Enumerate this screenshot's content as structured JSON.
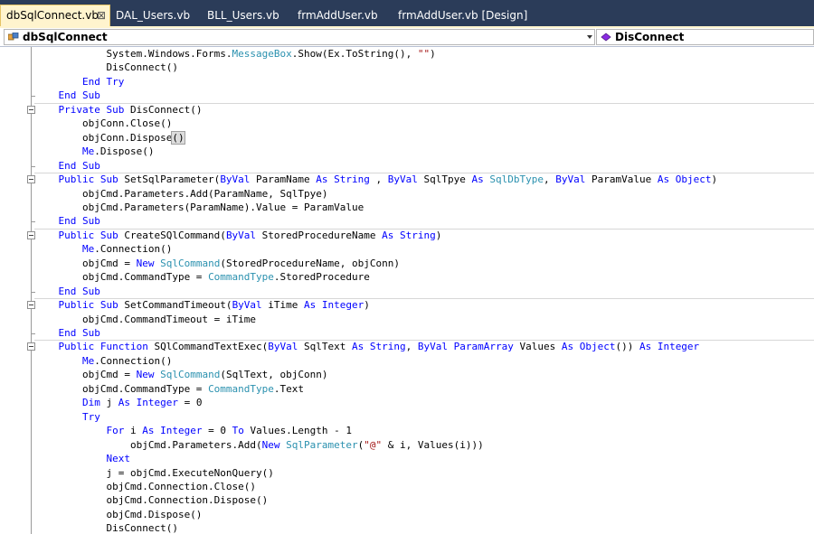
{
  "tabs": [
    {
      "label": "dbSqlConnect.vb",
      "active": true,
      "close": "⊠"
    },
    {
      "label": "DAL_Users.vb"
    },
    {
      "label": "BLL_Users.vb"
    },
    {
      "label": "frmAddUser.vb"
    },
    {
      "label": "frmAddUser.vb [Design]"
    }
  ],
  "navbar": {
    "class_combo": "dbSqlConnect",
    "member_combo": "DisConnect"
  },
  "colors": {
    "keyword": "#0000ff",
    "type": "#2b91af",
    "string": "#a31515",
    "tab_bar": "#2b3c59",
    "active_tab": "#fff4ce"
  },
  "code_lines": [
    [
      [
        "",
        "            System.Windows.Forms."
      ],
      [
        "t",
        "MessageBox"
      ],
      [
        "",
        ".Show(Ex.ToString(), "
      ],
      [
        "s",
        "\"\""
      ],
      [
        "",
        ")"
      ]
    ],
    [
      [
        "",
        "            DisConnect()"
      ]
    ],
    [
      [
        "k",
        "        End Try"
      ]
    ],
    [
      [
        "k",
        "    End Sub"
      ]
    ],
    [
      [
        "k",
        "    Private Sub"
      ],
      [
        "",
        " DisConnect()"
      ]
    ],
    [
      [
        "",
        "        objConn.Close()"
      ]
    ],
    [
      [
        "",
        "        objConn.Dispose"
      ],
      [
        "p",
        "()"
      ]
    ],
    [
      [
        "k",
        "        Me"
      ],
      [
        "",
        ".Dispose()"
      ]
    ],
    [
      [
        "k",
        "    End Sub"
      ]
    ],
    [
      [
        "k",
        "    Public Sub"
      ],
      [
        "",
        " SetSqlParameter("
      ],
      [
        "k",
        "ByVal"
      ],
      [
        "",
        " ParamName "
      ],
      [
        "k",
        "As String"
      ],
      [
        "",
        " , "
      ],
      [
        "k",
        "ByVal"
      ],
      [
        "",
        " SqlTpye "
      ],
      [
        "k",
        "As"
      ],
      [
        "",
        " "
      ],
      [
        "t",
        "SqlDbType"
      ],
      [
        "",
        ", "
      ],
      [
        "k",
        "ByVal"
      ],
      [
        "",
        " ParamValue "
      ],
      [
        "k",
        "As Object"
      ],
      [
        "",
        ")"
      ]
    ],
    [
      [
        "",
        "        objCmd.Parameters.Add(ParamName, SqlTpye)"
      ]
    ],
    [
      [
        "",
        "        objCmd.Parameters(ParamName).Value = ParamValue"
      ]
    ],
    [
      [
        "k",
        "    End Sub"
      ]
    ],
    [
      [
        "k",
        "    Public Sub"
      ],
      [
        "",
        " CreateSQlCommand("
      ],
      [
        "k",
        "ByVal"
      ],
      [
        "",
        " StoredProcedureName "
      ],
      [
        "k",
        "As String"
      ],
      [
        "",
        ")"
      ]
    ],
    [
      [
        "k",
        "        Me"
      ],
      [
        "",
        ".Connection()"
      ]
    ],
    [
      [
        "",
        "        objCmd = "
      ],
      [
        "k",
        "New"
      ],
      [
        "",
        " "
      ],
      [
        "t",
        "SqlCommand"
      ],
      [
        "",
        "(StoredProcedureName, objConn)"
      ]
    ],
    [
      [
        "",
        "        objCmd.CommandType = "
      ],
      [
        "t",
        "CommandType"
      ],
      [
        "",
        ".StoredProcedure"
      ]
    ],
    [
      [
        "k",
        "    End Sub"
      ]
    ],
    [
      [
        "k",
        "    Public Sub"
      ],
      [
        "",
        " SetCommandTimeout("
      ],
      [
        "k",
        "ByVal"
      ],
      [
        "",
        " iTime "
      ],
      [
        "k",
        "As Integer"
      ],
      [
        "",
        ")"
      ]
    ],
    [
      [
        "",
        "        objCmd.CommandTimeout = iTime"
      ]
    ],
    [
      [
        "k",
        "    End Sub"
      ]
    ],
    [
      [
        "k",
        "    Public Function"
      ],
      [
        "",
        " SQlCommandTextExec("
      ],
      [
        "k",
        "ByVal"
      ],
      [
        "",
        " SqlText "
      ],
      [
        "k",
        "As String"
      ],
      [
        "",
        ", "
      ],
      [
        "k",
        "ByVal ParamArray"
      ],
      [
        "",
        " Values "
      ],
      [
        "k",
        "As Object"
      ],
      [
        "",
        "()) "
      ],
      [
        "k",
        "As Integer"
      ]
    ],
    [
      [
        "k",
        "        Me"
      ],
      [
        "",
        ".Connection()"
      ]
    ],
    [
      [
        "",
        "        objCmd = "
      ],
      [
        "k",
        "New"
      ],
      [
        "",
        " "
      ],
      [
        "t",
        "SqlCommand"
      ],
      [
        "",
        "(SqlText, objConn)"
      ]
    ],
    [
      [
        "",
        "        objCmd.CommandType = "
      ],
      [
        "t",
        "CommandType"
      ],
      [
        "",
        ".Text"
      ]
    ],
    [
      [
        "k",
        "        Dim"
      ],
      [
        "",
        " j "
      ],
      [
        "k",
        "As Integer"
      ],
      [
        "",
        " = 0"
      ]
    ],
    [
      [
        "k",
        "        Try"
      ]
    ],
    [
      [
        "k",
        "            For"
      ],
      [
        "",
        " i "
      ],
      [
        "k",
        "As Integer"
      ],
      [
        "",
        " = 0 "
      ],
      [
        "k",
        "To"
      ],
      [
        "",
        " Values.Length - 1"
      ]
    ],
    [
      [
        "",
        "                objCmd.Parameters.Add("
      ],
      [
        "k",
        "New"
      ],
      [
        "",
        " "
      ],
      [
        "t",
        "SqlParameter"
      ],
      [
        "",
        "("
      ],
      [
        "s",
        "\"@\""
      ],
      [
        "",
        " & i, Values(i)))"
      ]
    ],
    [
      [
        "k",
        "            Next"
      ]
    ],
    [
      [
        "",
        "            j = objCmd.ExecuteNonQuery()"
      ]
    ],
    [
      [
        "",
        "            objCmd.Connection.Close()"
      ]
    ],
    [
      [
        "",
        "            objCmd.Connection.Dispose()"
      ]
    ],
    [
      [
        "",
        "            objCmd.Dispose()"
      ]
    ],
    [
      [
        "",
        "            DisConnect()"
      ]
    ]
  ]
}
